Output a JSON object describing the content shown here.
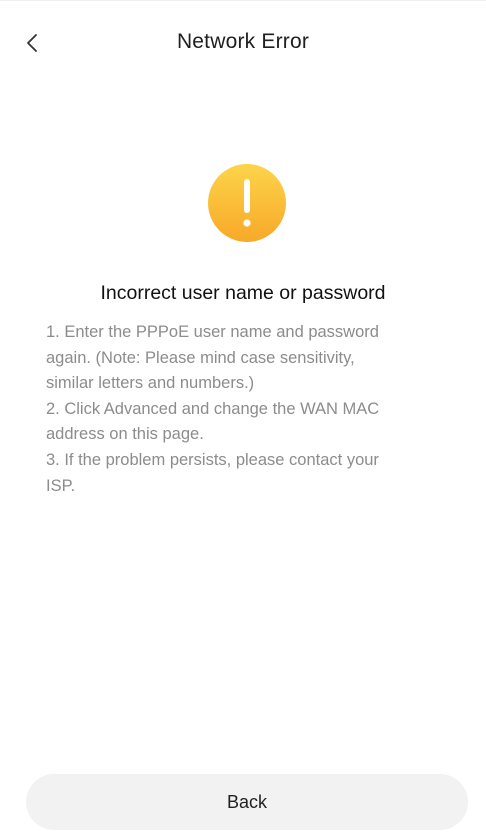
{
  "header": {
    "title": "Network Error",
    "back_icon": "chevron-left-icon"
  },
  "status": {
    "icon": "exclamation-warning-icon",
    "icon_color_top": "#FDD44A",
    "icon_color_bottom": "#F7A928"
  },
  "error": {
    "heading": "Incorrect user name or password",
    "description_lines": [
      "1. Enter the PPPoE user name and password",
      "again. (Note: Please mind case sensitivity,",
      "similar letters and numbers.)",
      "2. Click Advanced and change the WAN MAC",
      "address on this page.",
      "3. If the problem persists, please contact your",
      "ISP."
    ]
  },
  "footer": {
    "back_label": "Back"
  },
  "colors": {
    "text_primary": "#222222",
    "text_secondary": "#8C8C8C",
    "button_bg": "#F2F2F2"
  }
}
